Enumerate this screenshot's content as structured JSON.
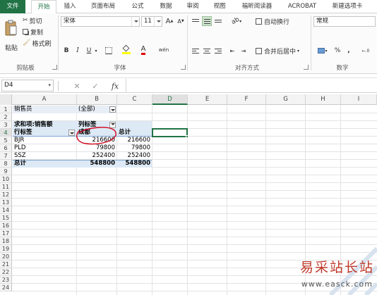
{
  "tabs": [
    "文件",
    "开始",
    "插入",
    "页面布局",
    "公式",
    "数据",
    "审阅",
    "视图",
    "福昕阅读器",
    "ACROBAT",
    "新建选项卡"
  ],
  "clipboard": {
    "paste_label": "粘贴",
    "cut_label": "剪切",
    "copy_label": "复制",
    "format_painter_label": "格式刷",
    "group_label": "剪贴板"
  },
  "font": {
    "name": "宋体",
    "size": "11",
    "grow_label": "A",
    "shrink_label": "A",
    "bold_label": "B",
    "italic_label": "I",
    "underline_label": "U",
    "font_color_label": "A",
    "phonetic_label": "wén",
    "group_label": "字体",
    "accent_fill": "#ffff00",
    "accent_font": "#e00000"
  },
  "alignment": {
    "wrap_label": "自动换行",
    "merge_label": "合并后居中",
    "group_label": "对齐方式"
  },
  "number": {
    "format": "常规",
    "percent_label": "%",
    "comma_label": ",",
    "group_label": "数字"
  },
  "formula_bar": {
    "name_box": "D4",
    "cancel_icon": "✕",
    "enter_icon": "✓",
    "fx_label": "fx",
    "value": ""
  },
  "sheet": {
    "columns": [
      "A",
      "B",
      "C",
      "D",
      "E",
      "F",
      "G",
      "H",
      "I"
    ],
    "selected_column": "D",
    "rows": [
      "1",
      "2",
      "3",
      "4",
      "5",
      "6",
      "7",
      "8",
      "9",
      "10",
      "11",
      "12",
      "13",
      "14",
      "15",
      "16",
      "17",
      "18",
      "19",
      "20",
      "21",
      "22",
      "23",
      "24",
      "25",
      "26"
    ],
    "selected_row": "4",
    "filter_label": "销售员",
    "filter_value": "(全部)",
    "value_header": "求和项:销售额",
    "col_labels_header": "列标签",
    "row_labels_header": "行标签",
    "column_item": "成都",
    "grand_total_header": "总计",
    "data_rows": [
      {
        "label": "BJR",
        "chengdu": "216600",
        "total": "216600"
      },
      {
        "label": "PLD",
        "chengdu": "79800",
        "total": "79800"
      },
      {
        "label": "SSZ",
        "chengdu": "252400",
        "total": "252400"
      }
    ],
    "total_row": {
      "label": "总计",
      "chengdu": "548800",
      "total": "548800"
    },
    "annotation_color": "#d0021b"
  },
  "watermark": {
    "text": "易采站长站",
    "url": "www.easck.com"
  }
}
